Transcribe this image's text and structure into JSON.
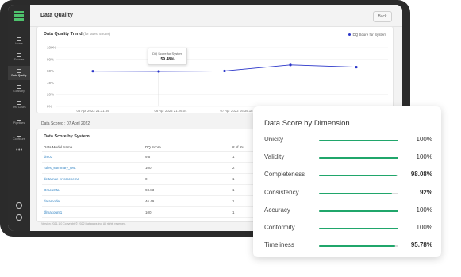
{
  "sidebar": {
    "items": [
      {
        "label": "Home",
        "active": false
      },
      {
        "label": "Sources",
        "active": false
      },
      {
        "label": "Data Quality",
        "active": true
      },
      {
        "label": "Glossary",
        "active": false
      },
      {
        "label": "Test Cases",
        "active": false
      },
      {
        "label": "Pipelines",
        "active": false
      },
      {
        "label": "Configure",
        "active": false
      }
    ],
    "more": "•••"
  },
  "header": {
    "title": "Data Quality",
    "back_label": "Back"
  },
  "trend": {
    "title": "Data Quality Trend",
    "subtitle": "(for latest 5 runs)",
    "legend": "DQ Score for System",
    "tooltip_label": "DQ Score for System",
    "tooltip_value": "59.48%"
  },
  "chart_data": {
    "type": "line",
    "x": [
      "06 Apr 2022 21:31:59",
      "06 Apr 2022 21:26:04",
      "07 Apr 2022 16:39:18"
    ],
    "y_ticks": [
      "100%",
      "80%",
      "60%",
      "40%",
      "20%",
      "0%"
    ],
    "ylim": [
      0,
      100
    ],
    "series": [
      {
        "name": "DQ Score for System",
        "values": [
          59.9,
          59.48,
          60.2,
          70.5,
          66.8
        ]
      }
    ],
    "color": "#2a35c9"
  },
  "scored": "Data Scored : 07 April 2022",
  "system": {
    "title": "Data Score by System",
    "columns": [
      "Data Model Name",
      "DQ Score",
      "# of Ru"
    ],
    "rows": [
      {
        "name": "dm03",
        "score": "9.5",
        "runs": "1"
      },
      {
        "name": "rules_summary_test",
        "score": "100",
        "runs": "2"
      },
      {
        "name": "delta rule errorschema",
        "score": "0",
        "runs": "1"
      },
      {
        "name": "OracleMa",
        "score": "93.83",
        "runs": "1"
      },
      {
        "name": "datamodel",
        "score": "46.49",
        "runs": "1"
      },
      {
        "name": "dlmacount1",
        "score": "100",
        "runs": "1"
      }
    ]
  },
  "footer": "Version 2021.1.0     Copyright © 2022 Datagaps Inc. All rights reserved.",
  "dimension_card": {
    "title": "Data Score by Dimension",
    "accent": "#20a66b",
    "dimensions": [
      {
        "label": "Unicity",
        "value": "100%",
        "fill": 1.0
      },
      {
        "label": "Validity",
        "value": "100%",
        "fill": 1.0
      },
      {
        "label": "Completeness",
        "value": "98.08%",
        "fill": 0.98
      },
      {
        "label": "Consistency",
        "value": "92%",
        "fill": 0.92
      },
      {
        "label": "Accuracy",
        "value": "100%",
        "fill": 1.0
      },
      {
        "label": "Conformity",
        "value": "100%",
        "fill": 1.0
      },
      {
        "label": "Timeliness",
        "value": "95.78%",
        "fill": 0.96
      }
    ]
  }
}
